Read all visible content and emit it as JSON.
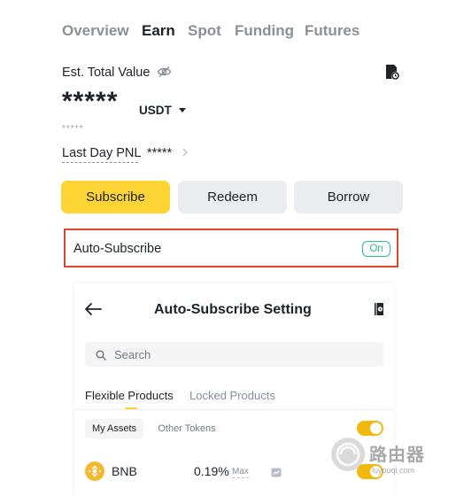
{
  "top_tabs": [
    {
      "label": "Overview"
    },
    {
      "label": "Earn",
      "active": true
    },
    {
      "label": "Spot"
    },
    {
      "label": "Funding"
    },
    {
      "label": "Futures"
    }
  ],
  "balance": {
    "label": "Est. Total Value",
    "value_hidden": "*****",
    "currency": "USDT",
    "sub_value_hidden": "*****",
    "pnl_label": "Last Day PNL",
    "pnl_value_hidden": "*****",
    "visibility_icon": "eye-off-icon",
    "history_icon": "document-clock-icon"
  },
  "actions": {
    "subscribe": "Subscribe",
    "redeem": "Redeem",
    "borrow": "Borrow"
  },
  "auto_subscribe": {
    "label": "Auto-Subscribe",
    "status": "On"
  },
  "settings_screen": {
    "title": "Auto-Subscribe Setting",
    "search_placeholder": "Search",
    "product_tabs": [
      {
        "label": "Flexible Products",
        "active": true
      },
      {
        "label": "Locked Products"
      }
    ],
    "chips": [
      {
        "label": "My Assets",
        "active": true
      },
      {
        "label": "Other Tokens"
      }
    ],
    "master_toggle_on": true,
    "assets": [
      {
        "coin": "BNB",
        "rate": "0.19%",
        "rate_tag": "Max",
        "auto_on": true
      }
    ]
  },
  "watermark": {
    "text": "路由器",
    "sub": "luyouqi.com"
  },
  "colors": {
    "accent": "#fcd535",
    "toggle_on": "#f0b90b",
    "green": "#2ebd85",
    "highlight_border": "#d9472b"
  }
}
